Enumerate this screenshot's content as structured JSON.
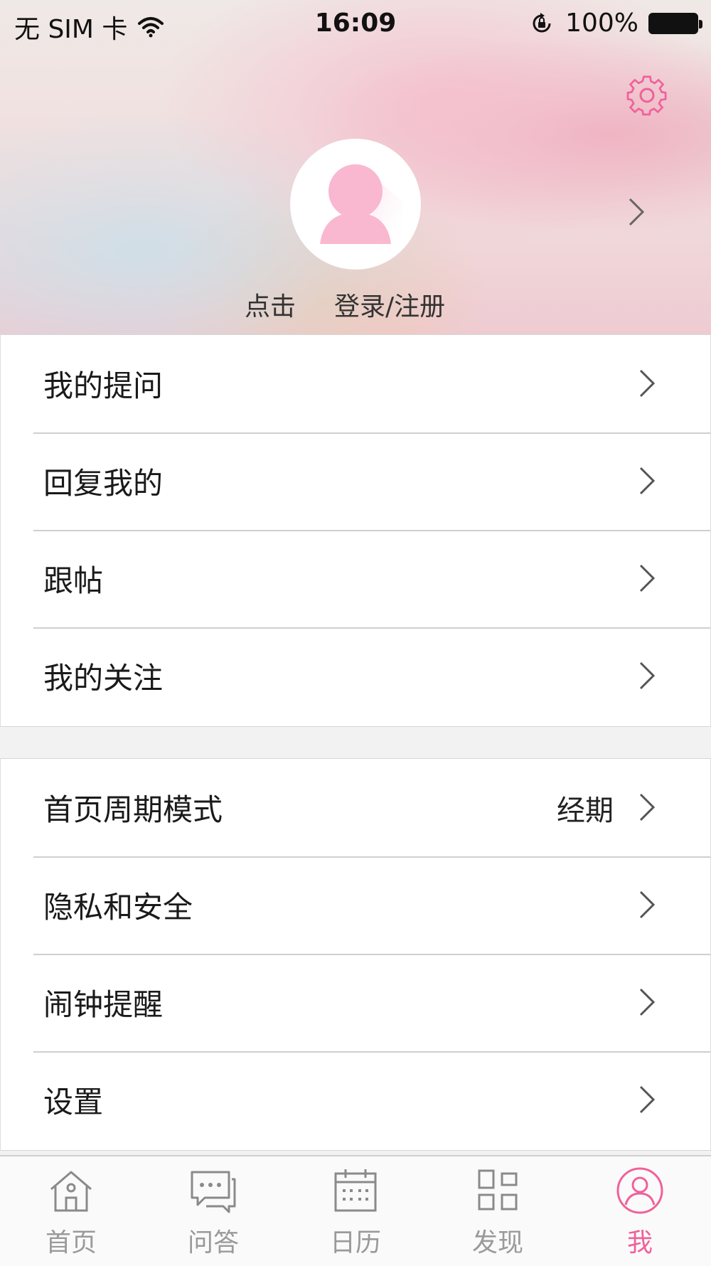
{
  "status_bar": {
    "carrier": "无 SIM 卡",
    "time": "16:09",
    "battery_percent": "100%"
  },
  "profile": {
    "click_text": "点击",
    "login_text": "登录/注册"
  },
  "menu_group_1": [
    {
      "label": "我的提问"
    },
    {
      "label": "回复我的"
    },
    {
      "label": "跟帖"
    },
    {
      "label": "我的关注"
    }
  ],
  "menu_group_2": [
    {
      "label": "首页周期模式",
      "value": "经期"
    },
    {
      "label": "隐私和安全"
    },
    {
      "label": "闹钟提醒"
    },
    {
      "label": "设置"
    }
  ],
  "tabbar": {
    "tabs": [
      {
        "label": "首页",
        "icon": "home-icon"
      },
      {
        "label": "问答",
        "icon": "chat-icon"
      },
      {
        "label": "日历",
        "icon": "calendar-icon"
      },
      {
        "label": "发现",
        "icon": "grid-icon"
      },
      {
        "label": "我",
        "icon": "person-icon"
      }
    ],
    "active_index": 4
  },
  "colors": {
    "accent": "#f0619a",
    "inactive_tab": "#9a9a9a",
    "avatar": "#f9b8d0"
  }
}
